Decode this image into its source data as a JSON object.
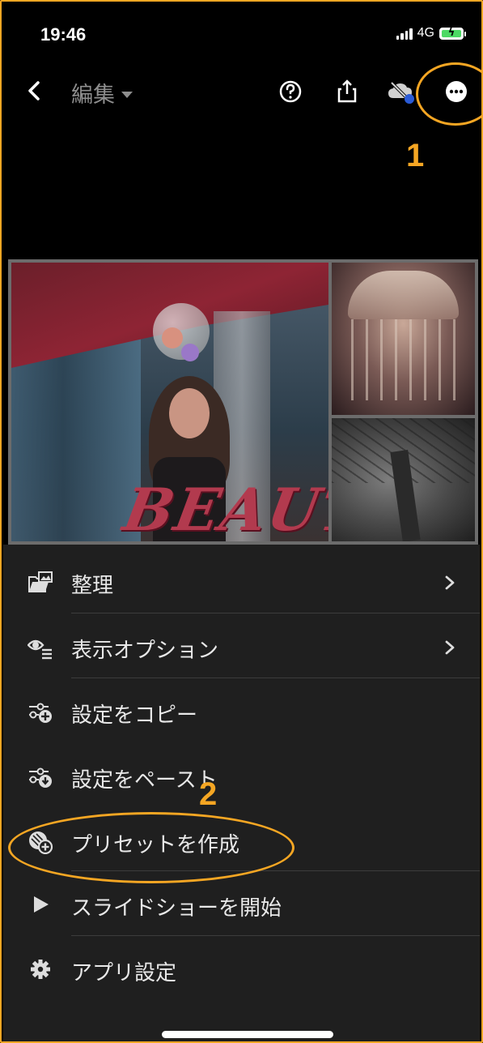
{
  "status_bar": {
    "time": "19:46",
    "network": "4G",
    "battery_charging": true,
    "battery_color": "#4cd964"
  },
  "toolbar": {
    "title": "編集",
    "icons": [
      "back-icon",
      "help-icon",
      "share-icon",
      "cloud-off-icon",
      "more-icon"
    ]
  },
  "annotations": {
    "step1": "1",
    "step2": "2",
    "color": "#f5a623"
  },
  "photo": {
    "overlay_text": "BEAUTY"
  },
  "menu": {
    "items": [
      {
        "label": "整理",
        "icon": "organize-icon",
        "has_submenu": true
      },
      {
        "label": "表示オプション",
        "icon": "view-options-icon",
        "has_submenu": true
      },
      {
        "label": "設定をコピー",
        "icon": "copy-settings-icon",
        "has_submenu": false
      },
      {
        "label": "設定をペースト",
        "icon": "paste-settings-icon",
        "has_submenu": false
      },
      {
        "label": "プリセットを作成",
        "icon": "create-preset-icon",
        "has_submenu": false
      },
      {
        "label": "スライドショーを開始",
        "icon": "play-icon",
        "has_submenu": false
      },
      {
        "label": "アプリ設定",
        "icon": "gear-icon",
        "has_submenu": false
      }
    ]
  }
}
